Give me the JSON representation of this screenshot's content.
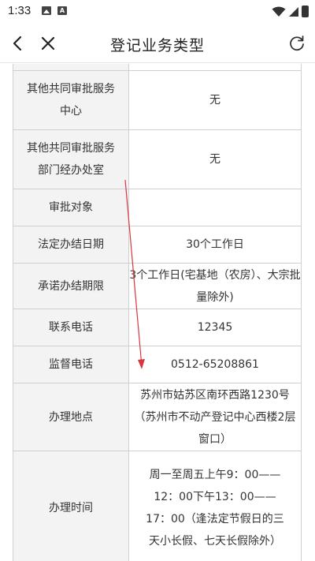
{
  "status_bar": {
    "time": "1:33",
    "icons": [
      "photo-icon",
      "a-icon",
      "wifi-icon",
      "signal-icon",
      "battery-icon"
    ],
    "a_icon_text": "A"
  },
  "nav": {
    "title": "登记业务类型",
    "icons": [
      "back-icon",
      "close-icon",
      "refresh-icon"
    ]
  },
  "table": {
    "rows": [
      {
        "label": "",
        "value": ""
      },
      {
        "label": "其他共同审批服务中心",
        "value": "无"
      },
      {
        "label": "其他共同审批服务部门经办处室",
        "value": "无"
      },
      {
        "label": "审批对象",
        "value": ""
      },
      {
        "label": "法定办结日期",
        "value": "30个工作日"
      },
      {
        "label": "承诺办结期限",
        "value": "3个工作日(宅基地（农房）、大宗批量除外)"
      },
      {
        "label": "联系电话",
        "value": "12345"
      },
      {
        "label": "监督电话",
        "value": "0512-65208861"
      },
      {
        "label": "办理地点",
        "value": "苏州市姑苏区南环西路1230号（苏州市不动产登记中心西楼2层窗口）"
      },
      {
        "label": "办理时间",
        "value": "周一至周五上午9：00——12：00下午13：00——17：00（逢法定节假日的三 天小长假、七天长假除外）"
      }
    ]
  },
  "colors": {
    "annotation_arrow": "#d9363e",
    "label_bg": "#f3f3f3",
    "border": "#cfcfcf"
  }
}
